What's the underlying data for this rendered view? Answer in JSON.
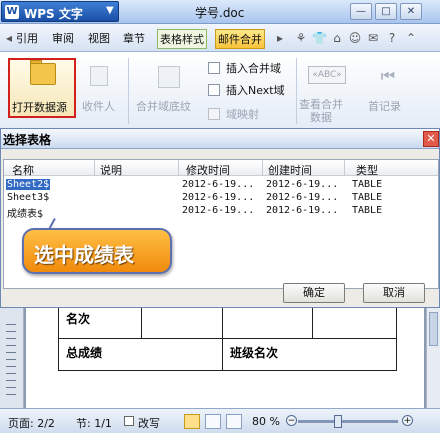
{
  "title_bar": {
    "app_name": "WPS 文字",
    "app_logo": "W",
    "doc_name": "学号.doc",
    "minimize_glyph": "—",
    "restore_glyph": "□",
    "close_glyph": "✕"
  },
  "tabs": [
    "引用",
    "审阅",
    "视图",
    "章节",
    "表格样式",
    "邮件合并"
  ],
  "ribbon": {
    "open_data_source": "打开数据源",
    "recipients": "收件人",
    "merge_field_underline": "合并域底纹",
    "insert_merge_field": "插入合并域",
    "insert_next_field": "插入Next域",
    "field_mapping": "域映射",
    "view_merged_data": "查看合并数据",
    "first_record": "首记录",
    "abc_glyph": "«ABC»"
  },
  "dialog": {
    "title": "选择表格",
    "columns": [
      "名称",
      "说明",
      "修改时间",
      "创建时间",
      "类型"
    ],
    "rows": [
      {
        "name": "Sheet2$",
        "desc": "",
        "modified": "2012-6-19...",
        "created": "2012-6-19...",
        "type": "TABLE"
      },
      {
        "name": "Sheet3$",
        "desc": "",
        "modified": "2012-6-19...",
        "created": "2012-6-19...",
        "type": "TABLE"
      },
      {
        "name": "成绩表$",
        "desc": "",
        "modified": "2012-6-19...",
        "created": "2012-6-19...",
        "type": "TABLE"
      }
    ],
    "ok": "确定",
    "cancel": "取消",
    "callout": "选中成绩表"
  },
  "document": {
    "cell_rank": "名次",
    "cell_total": "总成绩",
    "cell_class_rank": "班级名次"
  },
  "status_bar": {
    "page": "页面: 2/2",
    "section": "节: 1/1",
    "revise": "改写",
    "zoom": "80 %"
  },
  "colors": {
    "accent": "#1a4fa5",
    "highlight_border": "#d0211d",
    "selection": "#316ac5",
    "callout": "#f5a020"
  }
}
